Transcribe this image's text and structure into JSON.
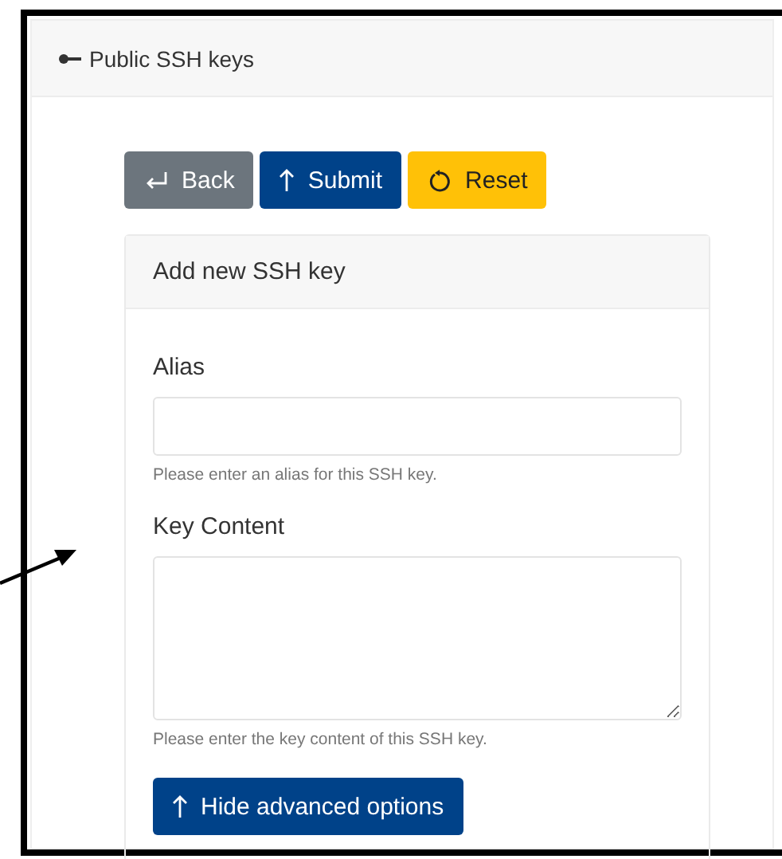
{
  "panel": {
    "title": "Public SSH keys"
  },
  "buttons": [
    {
      "label": "Back",
      "kind": "back"
    },
    {
      "label": "Submit",
      "kind": "submit"
    },
    {
      "label": "Reset",
      "kind": "reset"
    }
  ],
  "form": {
    "title": "Add new SSH key",
    "fields": [
      {
        "label": "Alias",
        "kind": "input",
        "help": "Please enter an alias for this SSH key."
      },
      {
        "label": "Key Content",
        "kind": "textarea",
        "help": "Please enter the key content of this SSH key."
      }
    ],
    "toggle_button": {
      "label": "Hide advanced options"
    }
  }
}
